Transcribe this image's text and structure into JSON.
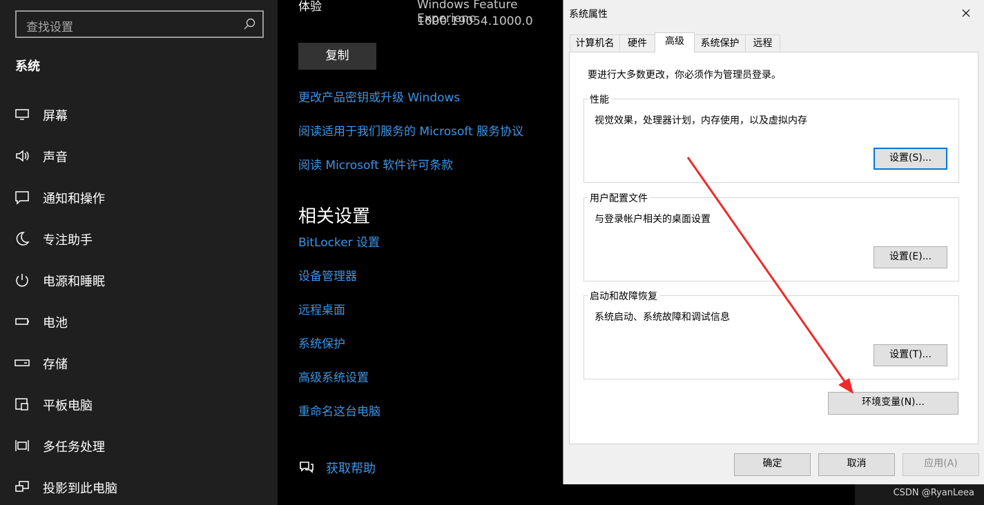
{
  "sidebar": {
    "search_placeholder": "查找设置",
    "title": "系统",
    "items": [
      {
        "label": "屏幕"
      },
      {
        "label": "声音"
      },
      {
        "label": "通知和操作"
      },
      {
        "label": "专注助手"
      },
      {
        "label": "电源和睡眠"
      },
      {
        "label": "电池"
      },
      {
        "label": "存储"
      },
      {
        "label": "平板电脑"
      },
      {
        "label": "多任务处理"
      },
      {
        "label": "投影到此电脑"
      }
    ]
  },
  "content": {
    "experience_label": "体验",
    "feature_experience": "Windows Feature Experienc",
    "version": "1000.19054.1000.0",
    "copy_label": "复制",
    "links_top": [
      "更改产品密钥或升级 Windows",
      "阅读适用于我们服务的 Microsoft 服务协议",
      "阅读 Microsoft 软件许可条款"
    ],
    "related_title": "相关设置",
    "related_links": [
      "BitLocker 设置",
      "设备管理器",
      "远程桌面",
      "系统保护",
      "高级系统设置",
      "重命名这台电脑"
    ],
    "help_label": "获取帮助"
  },
  "dialog": {
    "title": "系统属性",
    "tabs": [
      "计算机名",
      "硬件",
      "高级",
      "系统保护",
      "远程"
    ],
    "active_tab": "高级",
    "admin_note": "要进行大多数更改，你必须作为管理员登录。",
    "groups": [
      {
        "title": "性能",
        "desc": "视觉效果，处理器计划，内存使用，以及虚拟内存",
        "button": "设置(S)..."
      },
      {
        "title": "用户配置文件",
        "desc": "与登录帐户相关的桌面设置",
        "button": "设置(E)..."
      },
      {
        "title": "启动和故障恢复",
        "desc": "系统启动、系统故障和调试信息",
        "button": "设置(T)..."
      }
    ],
    "env_button": "环境变量(N)...",
    "ok": "确定",
    "cancel": "取消",
    "apply": "应用(A)"
  },
  "watermark": "CSDN @RyanLeea",
  "colors": {
    "link": "#3d95e6",
    "accent": "#0078d7",
    "arrow": "#ee2a2a"
  }
}
